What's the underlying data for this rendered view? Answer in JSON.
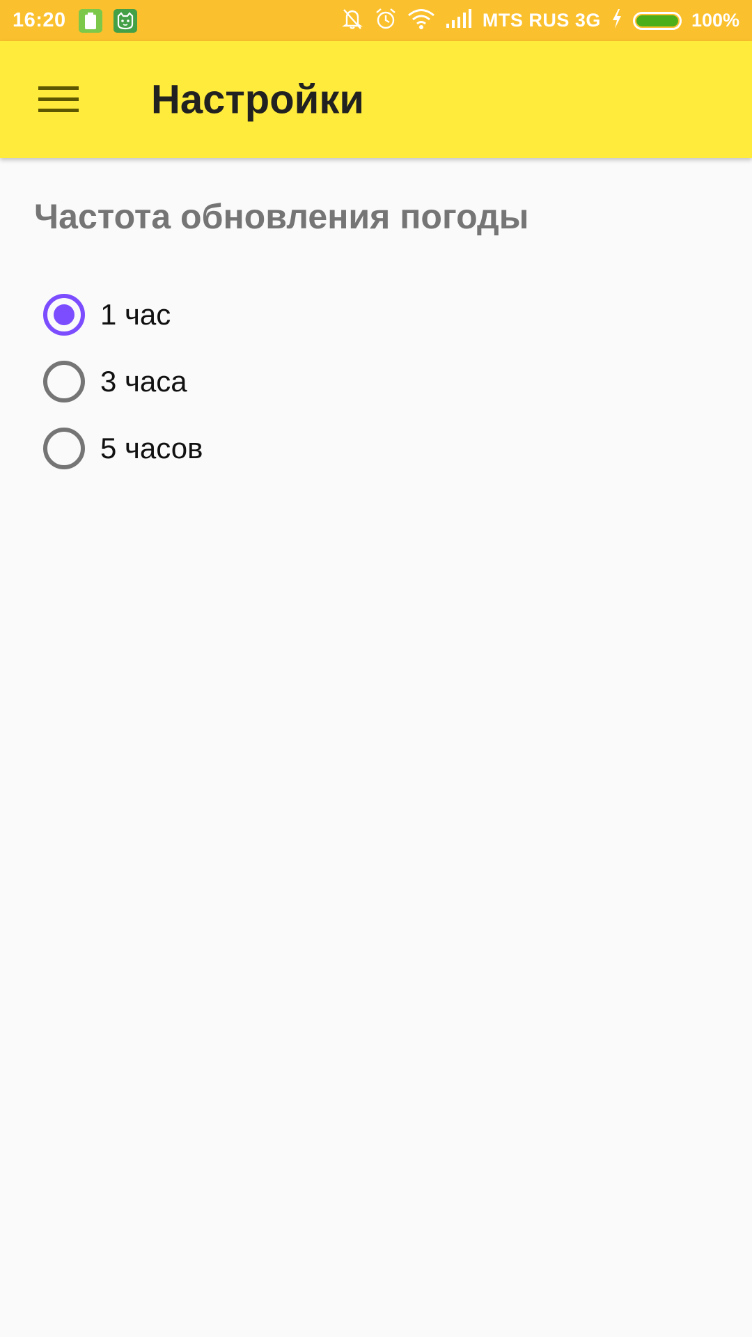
{
  "status_bar": {
    "time": "16:20",
    "carrier": "MTS RUS 3G",
    "battery_percent": "100%",
    "battery_level": 1.0,
    "icons": [
      "battery-notification-icon",
      "android-cat-icon",
      "silent-bell-icon",
      "alarm-icon",
      "wifi-icon",
      "signal-icon",
      "charging-bolt-icon"
    ],
    "bar_color": "#fbc02d",
    "battery_fill_color": "#4caf1a"
  },
  "toolbar": {
    "title": "Настройки",
    "menu_icon": "hamburger-menu-icon",
    "color": "#ffeb3b"
  },
  "settings": {
    "section_title": "Частота обновления погоды",
    "accent_color": "#7c4dff",
    "options": [
      {
        "label": "1 час",
        "checked": true
      },
      {
        "label": "3 часа",
        "checked": false
      },
      {
        "label": "5 часов",
        "checked": false
      }
    ]
  }
}
